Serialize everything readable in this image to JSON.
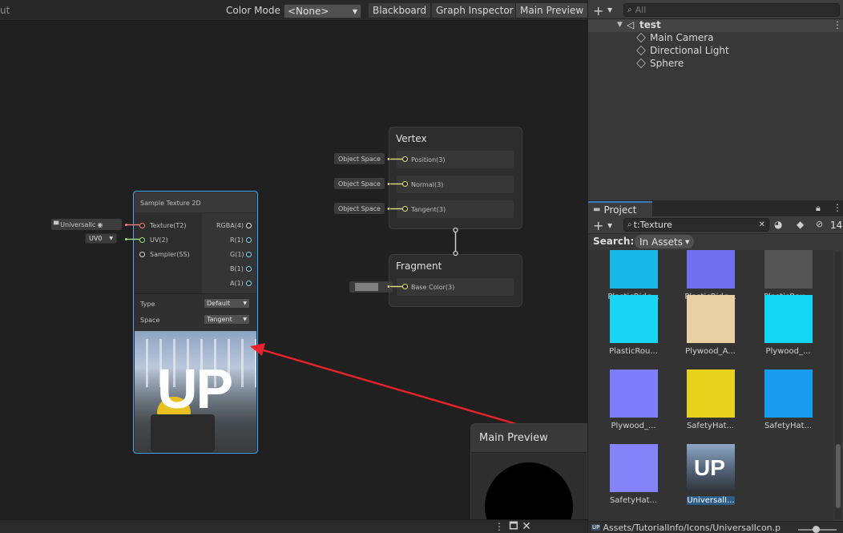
{
  "graph_toolbar": {
    "left_cut": "ut",
    "color_mode_label": "Color Mode",
    "color_mode_value": "<None>",
    "blackboard": "Blackboard",
    "graph_inspector": "Graph Inspector",
    "main_preview": "Main Preview"
  },
  "vertex": {
    "title": "Vertex",
    "slots": [
      "Position(3)",
      "Normal(3)",
      "Tangent(3)"
    ],
    "inputs": [
      "Object Space",
      "Object Space",
      "Object Space"
    ]
  },
  "fragment": {
    "title": "Fragment",
    "slot": "Base Color(3)"
  },
  "sample_texture": {
    "title": "Sample Texture 2D",
    "inputs": [
      "Texture(T2)",
      "UV(2)",
      "Sampler(SS)"
    ],
    "outputs": [
      "RGBA(4)",
      "R(1)",
      "G(1)",
      "B(1)",
      "A(1)"
    ],
    "texture_field": "UniversalIc",
    "uv_value": "UV0",
    "type_label": "Type",
    "type_value": "Default",
    "space_label": "Space",
    "space_value": "Tangent",
    "preview_text": "UP"
  },
  "main_preview_panel": {
    "title": "Main Preview"
  },
  "hierarchy": {
    "search_placeholder": "All",
    "scene": "test",
    "items": [
      "Main Camera",
      "Directional Light",
      "Sphere"
    ]
  },
  "project": {
    "tab": "Project",
    "search_value": "t:Texture",
    "hidden_count": "14",
    "search_label": "Search:",
    "scope": "In Assets",
    "assets": [
      {
        "label": "PlasticRidg...",
        "color": "#18b8e8"
      },
      {
        "label": "PlasticRidg...",
        "color": "#6f6ff0"
      },
      {
        "label": "PlasticRou...",
        "color": "#555555"
      },
      {
        "label": "PlasticRou...",
        "color": "#1ad4f4"
      },
      {
        "label": "Plywood_A...",
        "color": "#e8cfa4"
      },
      {
        "label": "Plywood_...",
        "color": "#12d6f2"
      },
      {
        "label": "Plywood_...",
        "color": "#7d7dfb"
      },
      {
        "label": "SafetyHat...",
        "color": "#e8d21c"
      },
      {
        "label": "SafetyHat...",
        "color": "#1a9cf0"
      },
      {
        "label": "SafetyHat...",
        "color": "#8484f8"
      },
      {
        "label": "UniversalI...",
        "color": "#3a4e66",
        "text": "UP"
      }
    ],
    "status_path": "Assets/TutorialInfo/Icons/UniversalIcon.p"
  }
}
